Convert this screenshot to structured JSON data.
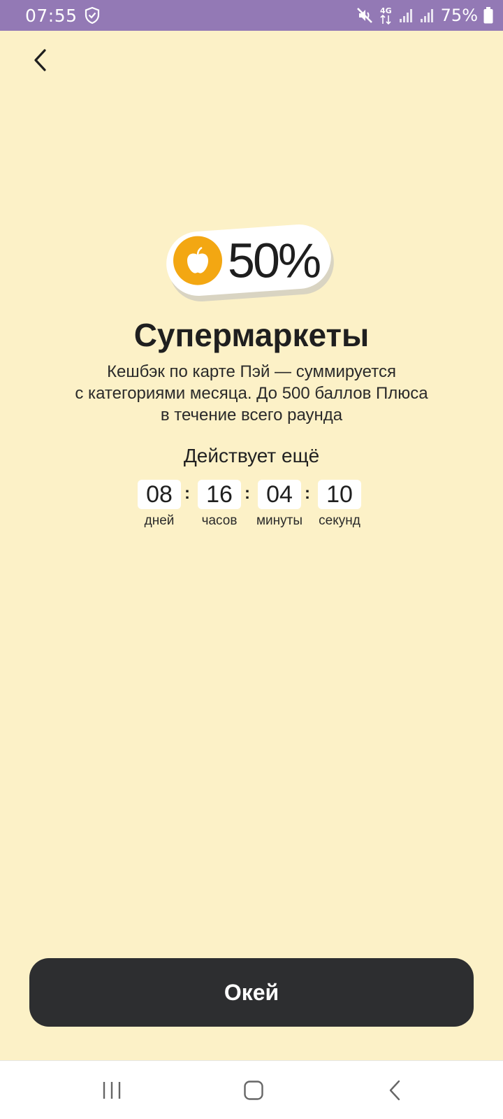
{
  "status_bar": {
    "time": "07:55",
    "battery": "75%",
    "network": "4G",
    "background_color": "#9379b5",
    "icons": [
      "shield-check-icon",
      "mute-icon",
      "network-4g-icon",
      "signal-icon",
      "signal-icon",
      "battery-icon"
    ]
  },
  "header": {
    "back_icon": "chevron-left-icon"
  },
  "badge": {
    "icon": "apple-icon",
    "percent": "50%",
    "accent_color": "#f3a712"
  },
  "title": "Супермаркеты",
  "description": {
    "line1": "Кешбэк по карте Пэй — суммируется",
    "line2": "с категориями месяца. До 500 баллов Плюса",
    "line3": "в течение всего раунда"
  },
  "timer": {
    "label": "Действует ещё",
    "units": [
      {
        "value": "08",
        "caption": "дней"
      },
      {
        "value": "16",
        "caption": "часов"
      },
      {
        "value": "04",
        "caption": "минуты"
      },
      {
        "value": "10",
        "caption": "секунд"
      }
    ],
    "separator": ":"
  },
  "primary_button": {
    "label": "Окей",
    "color": "#2d2e30"
  },
  "nav_bar": {
    "icons": [
      "recent-apps-icon",
      "home-icon",
      "back-icon"
    ]
  },
  "colors": {
    "background": "#fcf1c7"
  }
}
